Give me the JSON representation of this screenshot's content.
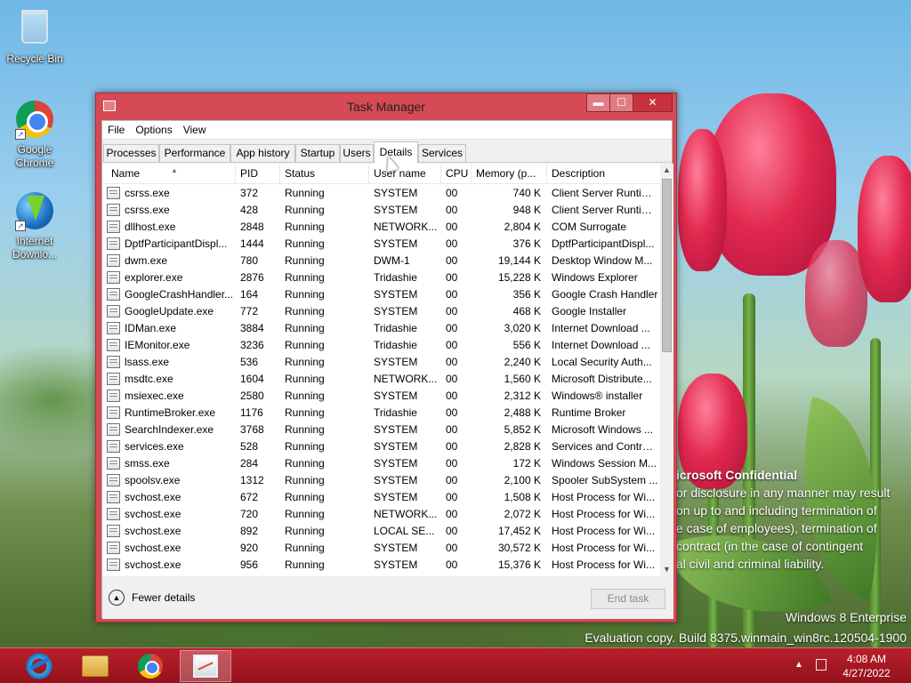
{
  "desktop": {
    "icons": [
      {
        "label": "Recycle Bin"
      },
      {
        "label": "Google Chrome"
      },
      {
        "label": "Internet Downlo..."
      }
    ],
    "watermark": {
      "title": "icrosoft Confidential",
      "lines": [
        "or disclosure in any manner may result",
        "on up to and including termination of",
        "e case of employees), termination of",
        "contract (in the case of contingent",
        "al civil and criminal liability."
      ],
      "edition": "Windows 8 Enterprise",
      "build": "Evaluation copy. Build 8375.winmain_win8rc.120504-1900"
    }
  },
  "window": {
    "title": "Task Manager",
    "controls": {
      "minimize": "▬",
      "maximize": "☐",
      "close": "✕"
    },
    "menu": [
      "File",
      "Options",
      "View"
    ],
    "tabs": [
      "Processes",
      "Performance",
      "App history",
      "Startup",
      "Users",
      "Details",
      "Services"
    ],
    "active_tab": "Details",
    "columns": [
      "Name",
      "PID",
      "Status",
      "User name",
      "CPU",
      "Memory (p...",
      "Description"
    ],
    "rows": [
      {
        "name": "csrss.exe",
        "pid": "372",
        "status": "Running",
        "user": "SYSTEM",
        "cpu": "00",
        "memory": "740 K",
        "description": "Client Server Runtim..."
      },
      {
        "name": "csrss.exe",
        "pid": "428",
        "status": "Running",
        "user": "SYSTEM",
        "cpu": "00",
        "memory": "948 K",
        "description": "Client Server Runtim..."
      },
      {
        "name": "dllhost.exe",
        "pid": "2848",
        "status": "Running",
        "user": "NETWORK...",
        "cpu": "00",
        "memory": "2,804 K",
        "description": "COM Surrogate"
      },
      {
        "name": "DptfParticipantDispl...",
        "pid": "1444",
        "status": "Running",
        "user": "SYSTEM",
        "cpu": "00",
        "memory": "376 K",
        "description": "DptfParticipantDispl..."
      },
      {
        "name": "dwm.exe",
        "pid": "780",
        "status": "Running",
        "user": "DWM-1",
        "cpu": "00",
        "memory": "19,144 K",
        "description": "Desktop Window M..."
      },
      {
        "name": "explorer.exe",
        "pid": "2876",
        "status": "Running",
        "user": "Tridashie",
        "cpu": "00",
        "memory": "15,228 K",
        "description": "Windows Explorer"
      },
      {
        "name": "GoogleCrashHandler...",
        "pid": "164",
        "status": "Running",
        "user": "SYSTEM",
        "cpu": "00",
        "memory": "356 K",
        "description": "Google Crash Handler"
      },
      {
        "name": "GoogleUpdate.exe",
        "pid": "772",
        "status": "Running",
        "user": "SYSTEM",
        "cpu": "00",
        "memory": "468 K",
        "description": "Google Installer"
      },
      {
        "name": "IDMan.exe",
        "pid": "3884",
        "status": "Running",
        "user": "Tridashie",
        "cpu": "00",
        "memory": "3,020 K",
        "description": "Internet Download ..."
      },
      {
        "name": "IEMonitor.exe",
        "pid": "3236",
        "status": "Running",
        "user": "Tridashie",
        "cpu": "00",
        "memory": "556 K",
        "description": "Internet Download ..."
      },
      {
        "name": "lsass.exe",
        "pid": "536",
        "status": "Running",
        "user": "SYSTEM",
        "cpu": "00",
        "memory": "2,240 K",
        "description": "Local Security Auth..."
      },
      {
        "name": "msdtc.exe",
        "pid": "1604",
        "status": "Running",
        "user": "NETWORK...",
        "cpu": "00",
        "memory": "1,560 K",
        "description": "Microsoft Distribute..."
      },
      {
        "name": "msiexec.exe",
        "pid": "2580",
        "status": "Running",
        "user": "SYSTEM",
        "cpu": "00",
        "memory": "2,312 K",
        "description": "Windows® installer"
      },
      {
        "name": "RuntimeBroker.exe",
        "pid": "1176",
        "status": "Running",
        "user": "Tridashie",
        "cpu": "00",
        "memory": "2,488 K",
        "description": "Runtime Broker"
      },
      {
        "name": "SearchIndexer.exe",
        "pid": "3768",
        "status": "Running",
        "user": "SYSTEM",
        "cpu": "00",
        "memory": "5,852 K",
        "description": "Microsoft Windows ..."
      },
      {
        "name": "services.exe",
        "pid": "528",
        "status": "Running",
        "user": "SYSTEM",
        "cpu": "00",
        "memory": "2,828 K",
        "description": "Services and Control..."
      },
      {
        "name": "smss.exe",
        "pid": "284",
        "status": "Running",
        "user": "SYSTEM",
        "cpu": "00",
        "memory": "172 K",
        "description": "Windows Session M..."
      },
      {
        "name": "spoolsv.exe",
        "pid": "1312",
        "status": "Running",
        "user": "SYSTEM",
        "cpu": "00",
        "memory": "2,100 K",
        "description": "Spooler SubSystem ..."
      },
      {
        "name": "svchost.exe",
        "pid": "672",
        "status": "Running",
        "user": "SYSTEM",
        "cpu": "00",
        "memory": "1,508 K",
        "description": "Host Process for Wi..."
      },
      {
        "name": "svchost.exe",
        "pid": "720",
        "status": "Running",
        "user": "NETWORK...",
        "cpu": "00",
        "memory": "2,072 K",
        "description": "Host Process for Wi..."
      },
      {
        "name": "svchost.exe",
        "pid": "892",
        "status": "Running",
        "user": "LOCAL SE...",
        "cpu": "00",
        "memory": "17,452 K",
        "description": "Host Process for Wi..."
      },
      {
        "name": "svchost.exe",
        "pid": "920",
        "status": "Running",
        "user": "SYSTEM",
        "cpu": "00",
        "memory": "30,572 K",
        "description": "Host Process for Wi..."
      },
      {
        "name": "svchost.exe",
        "pid": "956",
        "status": "Running",
        "user": "SYSTEM",
        "cpu": "00",
        "memory": "15,376 K",
        "description": "Host Process for Wi..."
      }
    ],
    "footer": {
      "fewer_details": "Fewer details",
      "end_task": "End task"
    }
  },
  "taskbar": {
    "apps": [
      "Internet Explorer",
      "File Explorer",
      "Google Chrome",
      "Task Manager"
    ],
    "time": "4:08 AM",
    "date": "4/27/2022"
  },
  "colors": {
    "accent": "#d54a55",
    "taskbar": "#b8202c"
  }
}
